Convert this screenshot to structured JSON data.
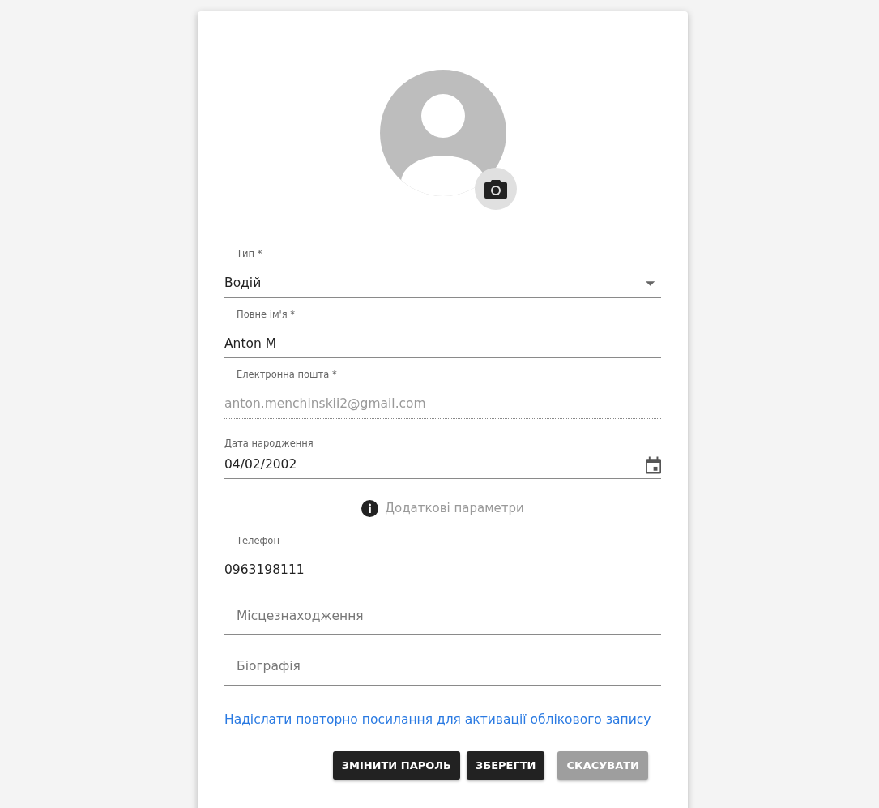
{
  "profile": {
    "avatar": {
      "kind": "placeholder"
    }
  },
  "fields": [
    {
      "kind": "select",
      "label": "Тип *",
      "value": "Водій"
    },
    {
      "kind": "text",
      "label": "Повне ім'я *",
      "value": "Anton M"
    },
    {
      "kind": "text",
      "label": "Електронна пошта *",
      "value": "anton.menchinskii2@gmail.com",
      "disabled": true
    },
    {
      "kind": "date",
      "label": "Дата народження",
      "value": "04/02/2002"
    },
    {
      "kind": "section",
      "label": "Додаткові параметри"
    },
    {
      "kind": "text",
      "label": "Телефон",
      "value": "0963198111"
    },
    {
      "kind": "text",
      "placeholder": "Місцезнаходження"
    },
    {
      "kind": "text",
      "placeholder": "Біографія"
    }
  ],
  "resend_link": "Надіслати повторно посилання для активації облікового запису",
  "buttons": [
    {
      "label": "ЗМІНИТИ ПАРОЛЬ",
      "disabled": false
    },
    {
      "label": "ЗБЕРЕГТИ",
      "disabled": false
    },
    {
      "label": "СКАСУВАТИ",
      "disabled": true
    }
  ]
}
